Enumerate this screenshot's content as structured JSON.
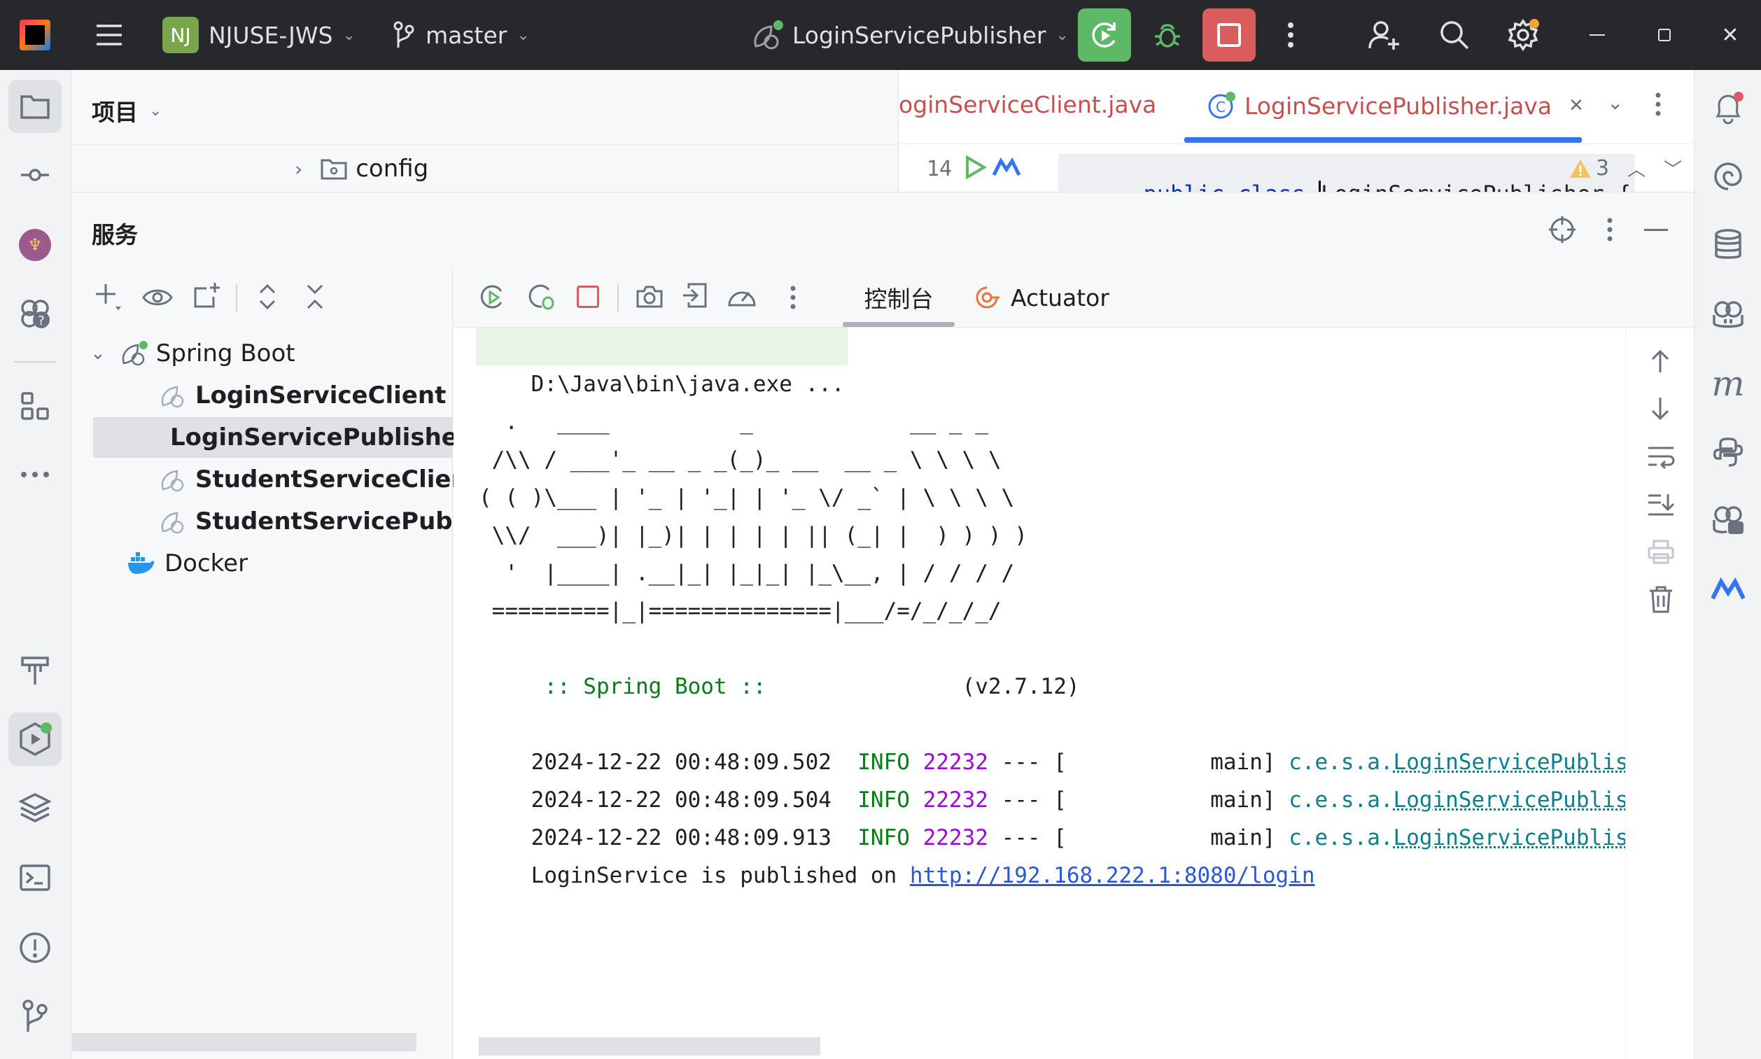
{
  "titlebar": {
    "project_badge": "NJ",
    "project_name": "NJUSE-JWS",
    "branch": "master",
    "run_config": "LoginServicePublisher"
  },
  "project_panel": {
    "title": "项目",
    "tree_item": "config"
  },
  "editor": {
    "tabs": [
      {
        "label": "oginServiceClient.java"
      },
      {
        "label": "LoginServicePublisher.java"
      }
    ],
    "line_number": "14",
    "code_keyword1": "public",
    "code_keyword2": "class",
    "code_classname": "LoginServicePublisher {",
    "warnings_count": "3"
  },
  "services": {
    "title": "服务",
    "tree": [
      {
        "label": "Spring Boot"
      },
      {
        "label": "LoginServiceClient"
      },
      {
        "label": "LoginServicePublisher"
      },
      {
        "label": "StudentServiceClient"
      },
      {
        "label": "StudentServicePublisher"
      },
      {
        "label": "Docker"
      }
    ],
    "tabs": [
      {
        "label": "控制台"
      },
      {
        "label": "Actuator"
      }
    ]
  },
  "console": {
    "command": "D:\\Java\\bin\\java.exe ...",
    "banner": [
      "  .   ____          _            __ _ _",
      " /\\\\ / ___'_ __ _ _(_)_ __  __ _ \\ \\ \\ \\",
      "( ( )\\___ | '_ | '_| | '_ \\/ _` | \\ \\ \\ \\",
      " \\\\/  ___)| |_)| | | | | || (_| |  ) ) ) )",
      "  '  |____| .__|_| |_|_| |_\\__, | / / / /",
      " =========|_|==============|___/=/_/_/_/"
    ],
    "spring_label": " :: Spring Boot ::",
    "spring_version": "(v2.7.12)",
    "log_lines": [
      {
        "time": "2024-12-22 00:48:09.502",
        "level": "INFO",
        "pid": "22232",
        "sep": "--- [",
        "thread": "main]",
        "logger_prefix": "c.e.s.a.",
        "logger": "LoginServicePublishe"
      },
      {
        "time": "2024-12-22 00:48:09.504",
        "level": "INFO",
        "pid": "22232",
        "sep": "--- [",
        "thread": "main]",
        "logger_prefix": "c.e.s.a.",
        "logger": "LoginServicePublishe"
      },
      {
        "time": "2024-12-22 00:48:09.913",
        "level": "INFO",
        "pid": "22232",
        "sep": "--- [",
        "thread": "main]",
        "logger_prefix": "c.e.s.a.",
        "logger": "LoginServicePublishe"
      }
    ],
    "published_text": "LoginService is published on ",
    "published_url": "http://192.168.222.1:8080/login"
  },
  "colors": {
    "run_green": "#5fb865",
    "stop_red": "#db5c5c",
    "accent_blue": "#3574f0",
    "title_bg": "#27282c"
  }
}
